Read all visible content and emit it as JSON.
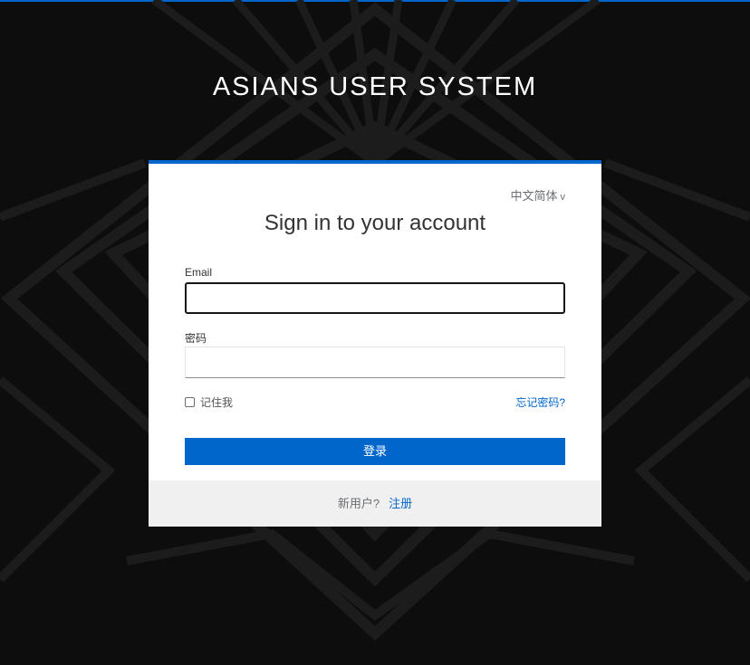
{
  "brand": {
    "title": "ASIANS USER SYSTEM"
  },
  "colors": {
    "accent": "#0066cc",
    "background": "#0d0d0d"
  },
  "card": {
    "language": {
      "label": "中文简体",
      "caret": "v"
    },
    "title": "Sign in to your account",
    "fields": {
      "email": {
        "label": "Email",
        "value": ""
      },
      "password": {
        "label": "密码",
        "value": ""
      }
    },
    "remember_me": {
      "label": "记住我",
      "checked": false
    },
    "forgot_password": "忘记密码?",
    "login_button": "登录",
    "footer": {
      "question": "新用户?",
      "register_link": "注册"
    }
  }
}
